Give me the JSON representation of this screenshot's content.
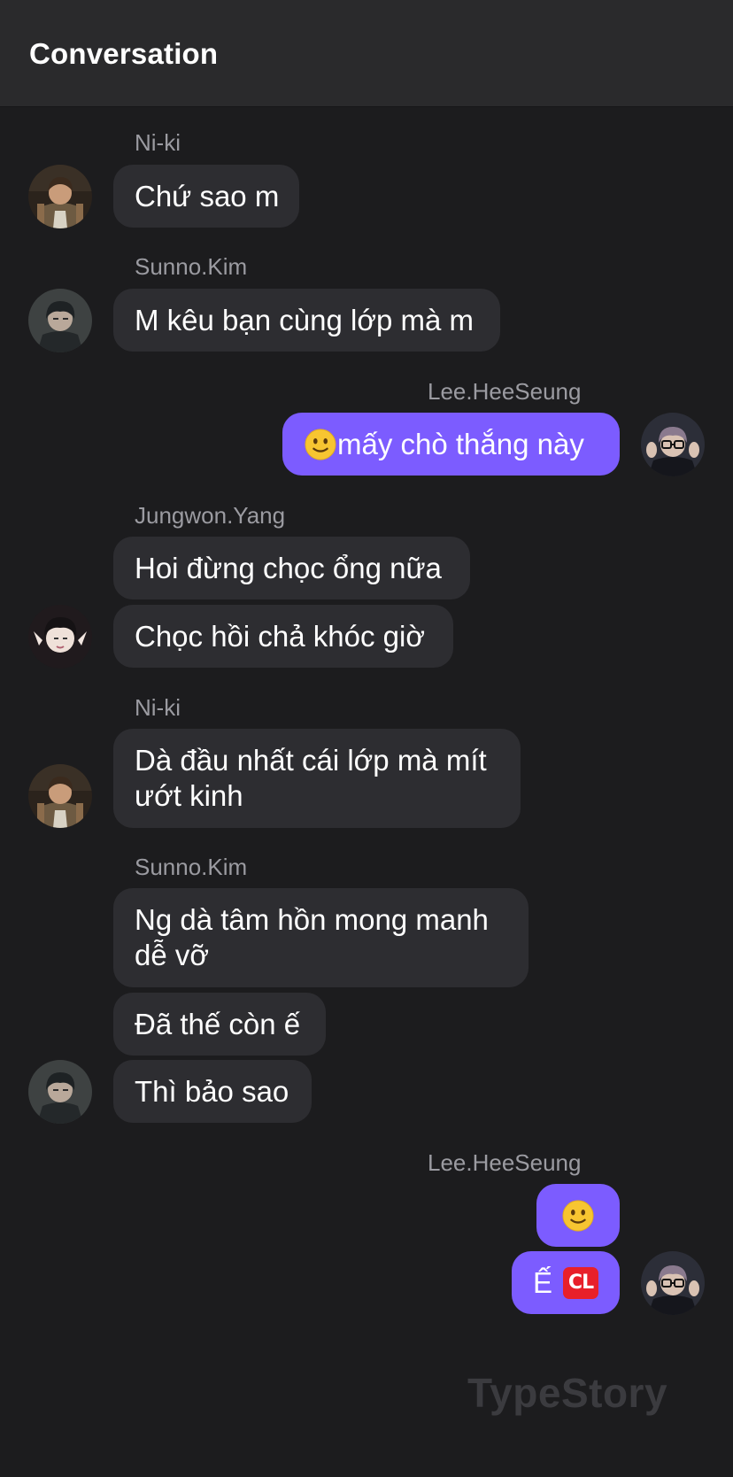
{
  "header": {
    "title": "Conversation"
  },
  "messages": [
    {
      "sender": "Ni-ki",
      "texts": [
        "Chứ sao m"
      ]
    },
    {
      "sender": "Sunno.Kim",
      "texts": [
        "M kêu bạn cùng lớp mà m"
      ]
    },
    {
      "sender": "Lee.HeeSeung",
      "texts": [
        "mấy chò thắng này"
      ],
      "emoji": [
        "slightly-smiling-face"
      ]
    },
    {
      "sender": "Jungwon.Yang",
      "texts": [
        "Hoi đừng chọc ổng nữa",
        "Chọc hồi chả khóc giờ"
      ]
    },
    {
      "sender": "Ni-ki",
      "texts": [
        "Dà đầu nhất cái lớp mà mít ướt kinh"
      ]
    },
    {
      "sender": "Sunno.Kim",
      "texts": [
        "Ng dà tâm hồn mong manh dễ vỡ",
        "Đã thế còn ế",
        "Thì bảo sao"
      ]
    },
    {
      "sender": "Lee.HeeSeung",
      "texts": [
        "",
        "Ế"
      ],
      "emoji": [
        "slightly-smiling-face",
        "cl-button"
      ]
    }
  ],
  "emoji_labels": {
    "cl": "CL"
  },
  "watermark": "TypeStory",
  "colors": {
    "background": "#1c1c1e",
    "header": "#2a2a2c",
    "incoming_bubble": "#2d2d31",
    "outgoing_bubble": "#7c5cff",
    "sender_name": "#9b9ba1"
  }
}
